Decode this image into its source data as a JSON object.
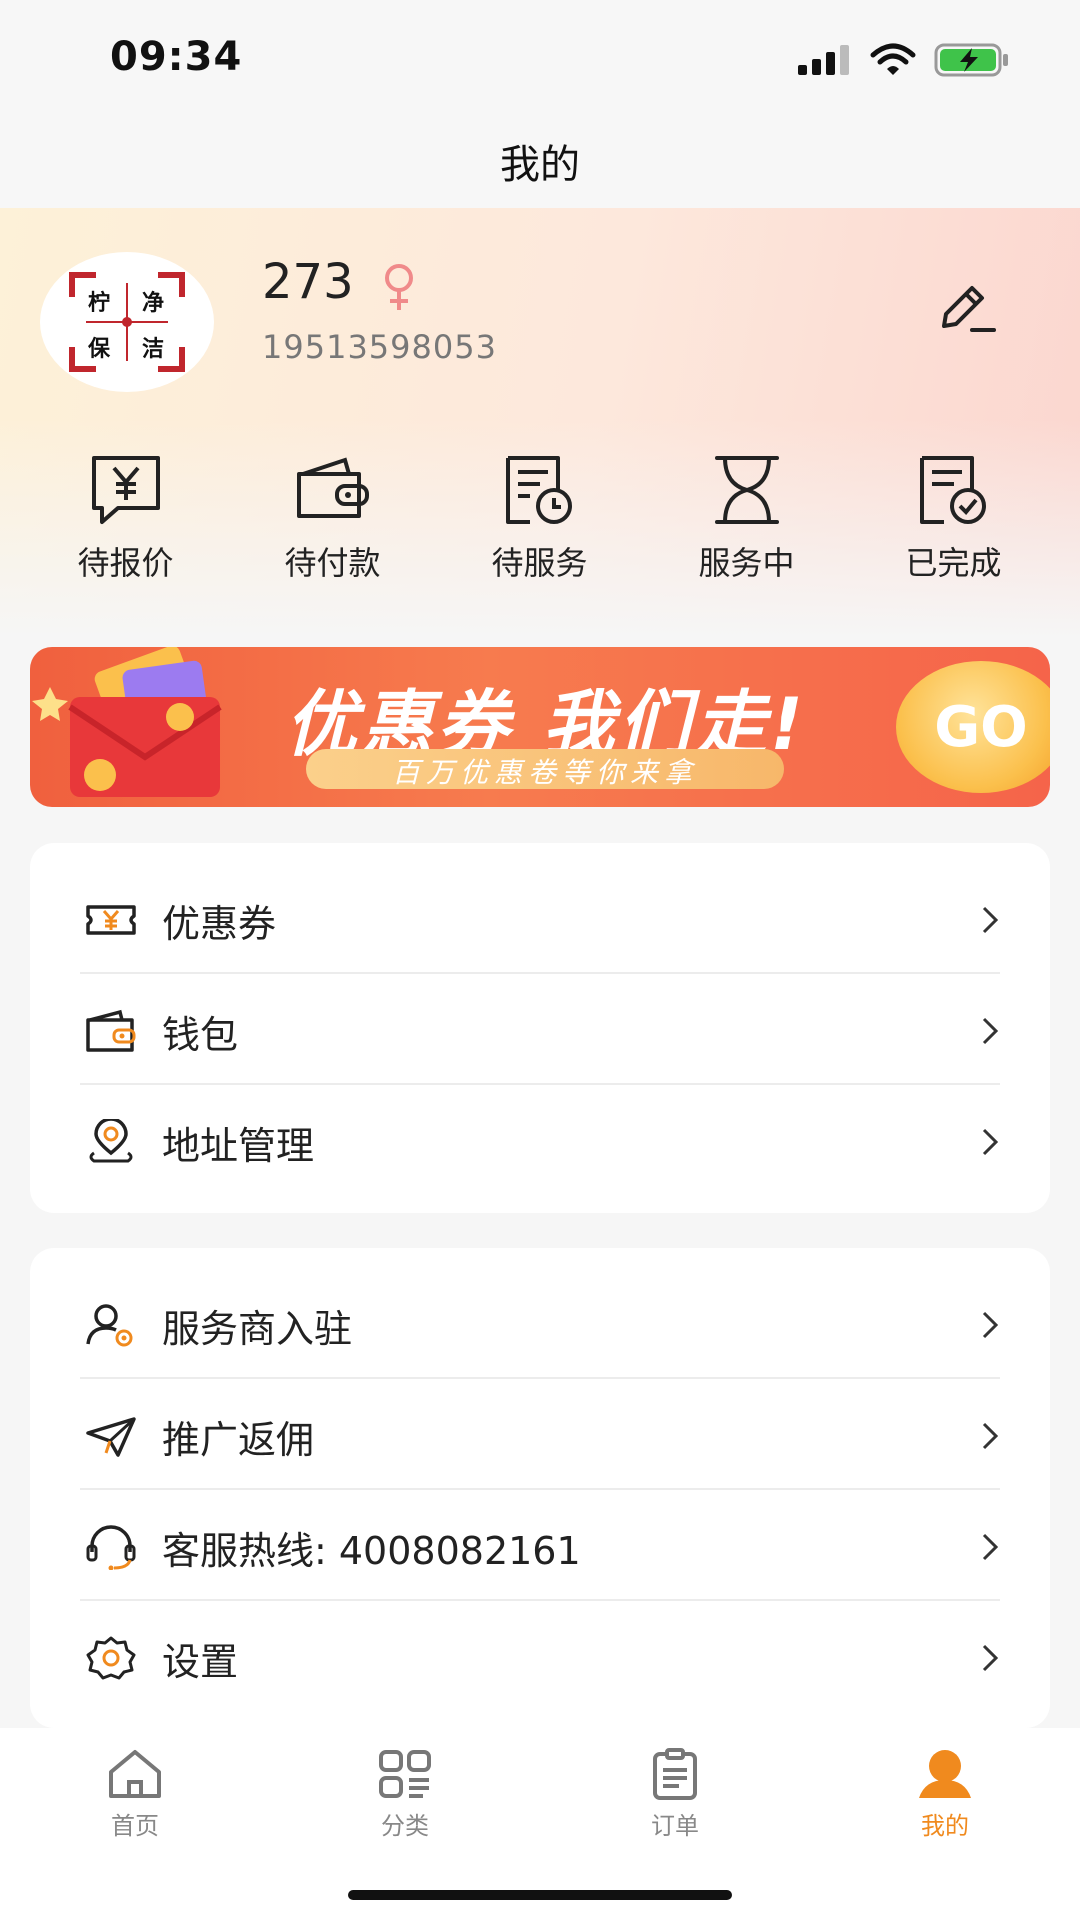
{
  "status_bar": {
    "time": "09:34"
  },
  "nav": {
    "title": "我的"
  },
  "profile": {
    "logo_chars": [
      "柠",
      "净",
      "保",
      "洁"
    ],
    "name": "273",
    "phone": "19513598053"
  },
  "order_status": [
    {
      "label": "待报价",
      "icon": "quote-icon"
    },
    {
      "label": "待付款",
      "icon": "wallet-icon"
    },
    {
      "label": "待服务",
      "icon": "clock-doc-icon"
    },
    {
      "label": "服务中",
      "icon": "hourglass-icon"
    },
    {
      "label": "已完成",
      "icon": "check-doc-icon"
    }
  ],
  "banner": {
    "title": "优惠券 我们走!",
    "subtitle": "百万优惠卷等你来拿",
    "button": "GO"
  },
  "menu_group_1": [
    {
      "label": "优惠券",
      "icon": "coupon-icon"
    },
    {
      "label": "钱包",
      "icon": "wallet-icon"
    },
    {
      "label": "地址管理",
      "icon": "location-icon"
    }
  ],
  "menu_group_2": [
    {
      "label": "服务商入驻",
      "icon": "user-gear-icon"
    },
    {
      "label": "推广返佣",
      "icon": "paper-plane-icon"
    },
    {
      "label": "客服热线: 4008082161",
      "icon": "headset-icon"
    },
    {
      "label": "设置",
      "icon": "gear-icon"
    }
  ],
  "tabbar": {
    "items": [
      {
        "label": "首页",
        "icon": "home-icon"
      },
      {
        "label": "分类",
        "icon": "grid-icon"
      },
      {
        "label": "订单",
        "icon": "clipboard-icon"
      },
      {
        "label": "我的",
        "icon": "person-icon"
      }
    ],
    "active_index": 3,
    "active_color": "#f08a1e",
    "inactive_color": "#888888"
  },
  "colors": {
    "accent": "#f08a1e",
    "gender_pink": "#f08a8a",
    "banner_red": "#f0603e"
  }
}
